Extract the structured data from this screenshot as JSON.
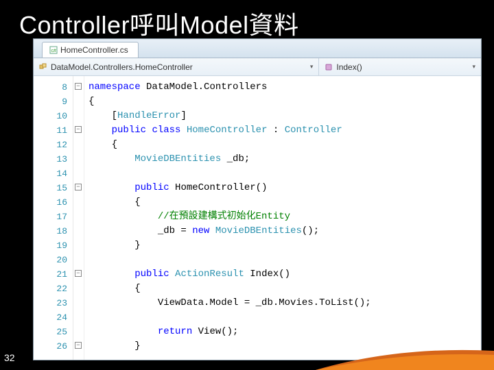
{
  "slide": {
    "title": "Controller呼叫Model資料",
    "page_number": "32"
  },
  "ide": {
    "tab": {
      "label": "HomeController.cs"
    },
    "nav": {
      "class_path": "DataModel.Controllers.HomeController",
      "member": "Index()"
    },
    "gutter": {
      "start": 8,
      "end": 26
    },
    "folds": [
      {
        "line": 8,
        "glyph": "−"
      },
      {
        "line": 11,
        "glyph": "−"
      },
      {
        "line": 15,
        "glyph": "−"
      },
      {
        "line": 21,
        "glyph": "−"
      },
      {
        "line": 26,
        "glyph": "−"
      }
    ],
    "code": {
      "l8_kw": "namespace",
      "l8_rest": " DataModel.Controllers",
      "l9": "{",
      "l10_attr": "HandleError",
      "l11_kw1": "public",
      "l11_kw2": "class",
      "l11_name": "HomeController",
      "l11_base": "Controller",
      "l12": "{",
      "l13_type": "MovieDBEntities",
      "l13_field": " _db;",
      "l15_kw": "public",
      "l15_ctor": " HomeController()",
      "l16": "{",
      "l17_comment": "//在預設建構式初始化Entity",
      "l18_lhs": "_db = ",
      "l18_kw": "new",
      "l18_type": "MovieDBEntities",
      "l18_tail": "();",
      "l19": "}",
      "l21_kw": "public",
      "l21_type": "ActionResult",
      "l21_name": " Index()",
      "l22": "{",
      "l23": "ViewData.Model = _db.Movies.ToList();",
      "l25_kw": "return",
      "l25_rest": " View();",
      "l26": "}"
    }
  }
}
